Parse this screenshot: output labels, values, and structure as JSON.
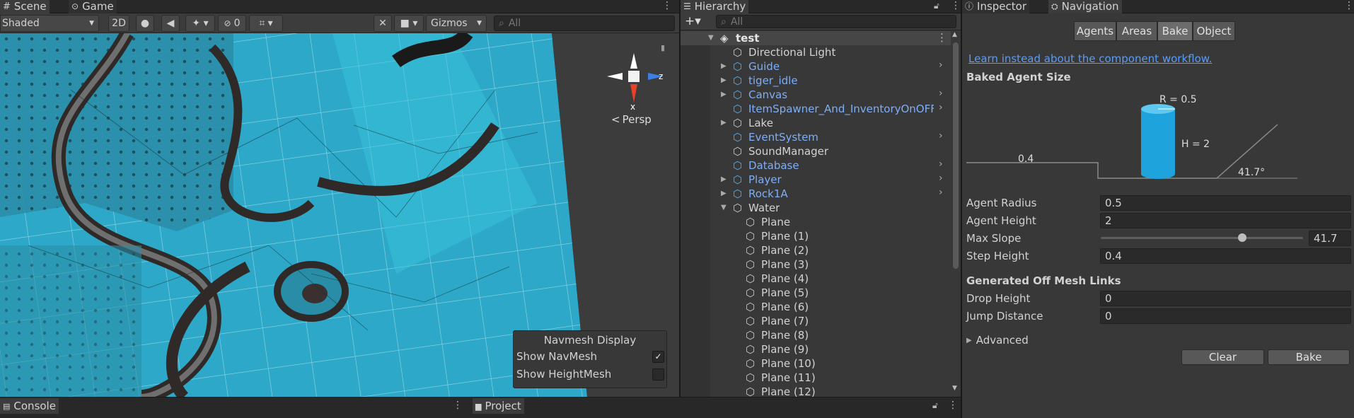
{
  "scene_tabs": {
    "scene": "Scene",
    "game": "Game"
  },
  "scene_toolbar": {
    "shading": "Shaded",
    "mode_2d": "2D",
    "hidden_count": "0",
    "gizmos": "Gizmos",
    "search_placeholder": "All"
  },
  "gizmo": {
    "x": "x",
    "z": "z",
    "persp": "Persp"
  },
  "navmesh_overlay": {
    "title": "Navmesh Display",
    "items": [
      {
        "label": "Show NavMesh",
        "checked": true
      },
      {
        "label": "Show HeightMesh",
        "checked": false
      }
    ]
  },
  "hierarchy": {
    "title": "Hierarchy",
    "search_placeholder": "All",
    "scene_name": "test",
    "items": [
      {
        "label": "Directional Light",
        "prefab": false,
        "expand": "none",
        "chevron": false,
        "indent": 1
      },
      {
        "label": "Guide",
        "prefab": true,
        "expand": "collapsed",
        "chevron": true,
        "indent": 1
      },
      {
        "label": "tiger_idle",
        "prefab": true,
        "expand": "collapsed",
        "chevron": false,
        "indent": 1
      },
      {
        "label": "Canvas",
        "prefab": true,
        "expand": "collapsed",
        "chevron": true,
        "indent": 1
      },
      {
        "label": "ItemSpawner_And_InventoryOnOFFM",
        "prefab": true,
        "expand": "none",
        "chevron": true,
        "indent": 1
      },
      {
        "label": "Lake",
        "prefab": false,
        "expand": "collapsed",
        "chevron": false,
        "indent": 1
      },
      {
        "label": "EventSystem",
        "prefab": true,
        "expand": "none",
        "chevron": true,
        "indent": 1
      },
      {
        "label": "SoundManager",
        "prefab": false,
        "expand": "none",
        "chevron": false,
        "indent": 1
      },
      {
        "label": "Database",
        "prefab": true,
        "expand": "none",
        "chevron": true,
        "indent": 1
      },
      {
        "label": "Player",
        "prefab": true,
        "expand": "collapsed",
        "chevron": true,
        "indent": 1
      },
      {
        "label": "Rock1A",
        "prefab": true,
        "expand": "collapsed",
        "chevron": true,
        "indent": 1
      },
      {
        "label": "Water",
        "prefab": false,
        "expand": "expanded",
        "chevron": false,
        "indent": 1
      },
      {
        "label": "Plane",
        "prefab": false,
        "expand": "none",
        "chevron": false,
        "indent": 2
      },
      {
        "label": "Plane (1)",
        "prefab": false,
        "expand": "none",
        "chevron": false,
        "indent": 2
      },
      {
        "label": "Plane (2)",
        "prefab": false,
        "expand": "none",
        "chevron": false,
        "indent": 2
      },
      {
        "label": "Plane (3)",
        "prefab": false,
        "expand": "none",
        "chevron": false,
        "indent": 2
      },
      {
        "label": "Plane (4)",
        "prefab": false,
        "expand": "none",
        "chevron": false,
        "indent": 2
      },
      {
        "label": "Plane (5)",
        "prefab": false,
        "expand": "none",
        "chevron": false,
        "indent": 2
      },
      {
        "label": "Plane (6)",
        "prefab": false,
        "expand": "none",
        "chevron": false,
        "indent": 2
      },
      {
        "label": "Plane (7)",
        "prefab": false,
        "expand": "none",
        "chevron": false,
        "indent": 2
      },
      {
        "label": "Plane (8)",
        "prefab": false,
        "expand": "none",
        "chevron": false,
        "indent": 2
      },
      {
        "label": "Plane (9)",
        "prefab": false,
        "expand": "none",
        "chevron": false,
        "indent": 2
      },
      {
        "label": "Plane (10)",
        "prefab": false,
        "expand": "none",
        "chevron": false,
        "indent": 2
      },
      {
        "label": "Plane (11)",
        "prefab": false,
        "expand": "none",
        "chevron": false,
        "indent": 2
      },
      {
        "label": "Plane (12)",
        "prefab": false,
        "expand": "none",
        "chevron": false,
        "indent": 2
      }
    ]
  },
  "right_tabs": {
    "inspector": "Inspector",
    "navigation": "Navigation"
  },
  "navigation": {
    "tabs": [
      "Agents",
      "Areas",
      "Bake",
      "Object"
    ],
    "selected_tab": "Bake",
    "link": "Learn instead about the component workflow.",
    "baked_agent_size": "Baked Agent Size",
    "diagram": {
      "radius": "R = 0.5",
      "height": "H = 2",
      "step": "0.4",
      "slope": "41.7°"
    },
    "fields": [
      {
        "label": "Agent Radius",
        "value": "0.5"
      },
      {
        "label": "Agent Height",
        "value": "2"
      },
      {
        "label": "Max Slope",
        "value": "41.7",
        "slider_fraction": 0.7
      },
      {
        "label": "Step Height",
        "value": "0.4"
      }
    ],
    "offmesh_header": "Generated Off Mesh Links",
    "offmesh_fields": [
      {
        "label": "Drop Height",
        "value": "0"
      },
      {
        "label": "Jump Distance",
        "value": "0"
      }
    ],
    "advanced": "Advanced",
    "clear": "Clear",
    "bake": "Bake"
  },
  "bottom_tabs": {
    "console": "Console",
    "project": "Project"
  },
  "colors": {
    "accent_blue": "#7eaef5",
    "link": "#5b9cf5",
    "navmesh": "#30b8d8",
    "selected_tab": "#6c6c6c"
  }
}
